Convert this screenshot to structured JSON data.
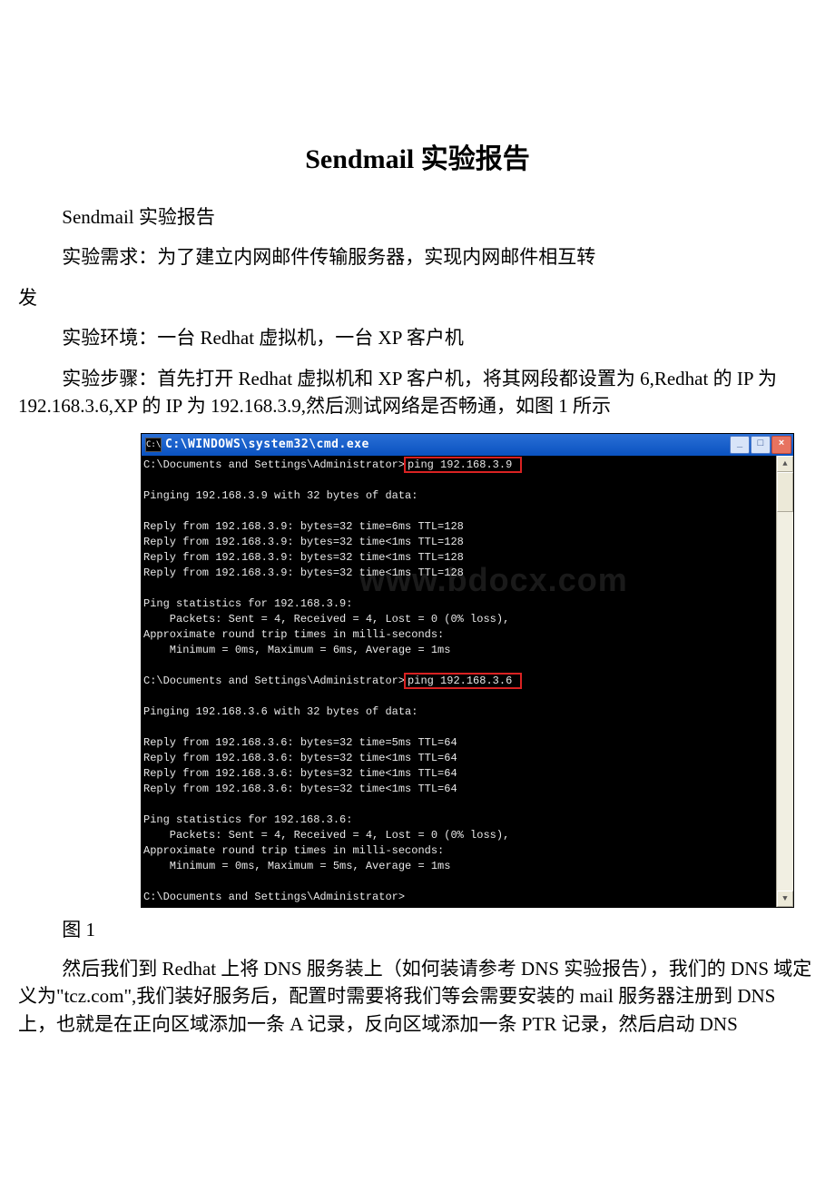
{
  "doc": {
    "title": "Sendmail 实验报告",
    "p1": "Sendmail 实验报告",
    "p2": "实验需求：为了建立内网邮件传输服务器，实现内网邮件相互转",
    "p2b": "发",
    "p3": "实验环境：一台 Redhat 虚拟机，一台 XP 客户机",
    "p4": "实验步骤：首先打开 Redhat 虚拟机和 XP 客户机，将其网段都设置为 6,Redhat 的 IP 为 192.168.3.6,XP 的 IP 为 192.168.3.9,然后测试网络是否畅通，如图 1 所示",
    "fig1_label": "图 1",
    "p5": "然后我们到 Redhat 上将 DNS 服务装上（如何装请参考 DNS 实验报告），我们的 DNS 域定义为\"tcz.com\",我们装好服务后，配置时需要将我们等会需要安装的 mail 服务器注册到 DNS 上，也就是在正向区域添加一条 A 记录，反向区域添加一条 PTR 记录，然后启动 DNS"
  },
  "cmd": {
    "icon_text": "C:\\",
    "title": "C:\\WINDOWS\\system32\\cmd.exe",
    "min_label": "_",
    "max_label": "□",
    "close_label": "×",
    "scroll_up": "▲",
    "scroll_down": "▼",
    "watermark": "www.bdocx.com",
    "prompt1_pre": "C:\\Documents and Settings\\Administrator>",
    "prompt1_cmd": "ping 192.168.3.9 ",
    "ping1_header": "Pinging 192.168.3.9 with 32 bytes of data:",
    "ping1_l1": "Reply from 192.168.3.9: bytes=32 time=6ms TTL=128",
    "ping1_l2": "Reply from 192.168.3.9: bytes=32 time<1ms TTL=128",
    "ping1_l3": "Reply from 192.168.3.9: bytes=32 time<1ms TTL=128",
    "ping1_l4": "Reply from 192.168.3.9: bytes=32 time<1ms TTL=128",
    "stats1_h": "Ping statistics for 192.168.3.9:",
    "stats1_l1": "    Packets: Sent = 4, Received = 4, Lost = 0 (0% loss),",
    "stats1_l2": "Approximate round trip times in milli-seconds:",
    "stats1_l3": "    Minimum = 0ms, Maximum = 6ms, Average = 1ms",
    "prompt2_pre": "C:\\Documents and Settings\\Administrator>",
    "prompt2_cmd": "ping 192.168.3.6 ",
    "ping2_header": "Pinging 192.168.3.6 with 32 bytes of data:",
    "ping2_l1": "Reply from 192.168.3.6: bytes=32 time=5ms TTL=64",
    "ping2_l2": "Reply from 192.168.3.6: bytes=32 time<1ms TTL=64",
    "ping2_l3": "Reply from 192.168.3.6: bytes=32 time<1ms TTL=64",
    "ping2_l4": "Reply from 192.168.3.6: bytes=32 time<1ms TTL=64",
    "stats2_h": "Ping statistics for 192.168.3.6:",
    "stats2_l1": "    Packets: Sent = 4, Received = 4, Lost = 0 (0% loss),",
    "stats2_l2": "Approximate round trip times in milli-seconds:",
    "stats2_l3": "    Minimum = 0ms, Maximum = 5ms, Average = 1ms",
    "prompt3": "C:\\Documents and Settings\\Administrator>"
  }
}
